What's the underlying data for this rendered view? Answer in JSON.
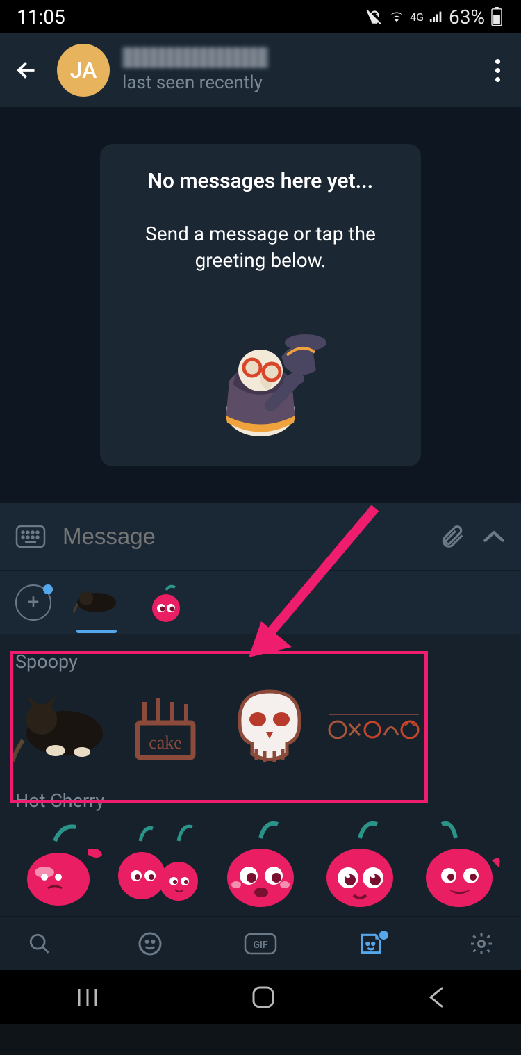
{
  "status": {
    "time": "11:05",
    "network": "4G",
    "battery": "63%"
  },
  "header": {
    "avatar_initials": "JA",
    "last_seen": "last seen recently"
  },
  "greeting": {
    "title": "No messages here yet...",
    "subtitle": "Send a message or tap the greeting below.",
    "sticker_name": "plague-doctor-greeting-sticker"
  },
  "input": {
    "placeholder": "Message"
  },
  "sticker_tabs": {
    "packs": [
      "spoopy-cat-thumb",
      "hot-cherry-thumb"
    ],
    "active_index": 0
  },
  "packs": [
    {
      "name": "Spoopy",
      "stickers": [
        "cat-sticker",
        "cake-sticker",
        "skull-sticker",
        "pumpkins-sticker"
      ]
    },
    {
      "name": "Hot Cherry",
      "stickers": [
        "cherry-1",
        "cherry-2",
        "cherry-3",
        "cherry-4",
        "cherry-5"
      ]
    }
  ],
  "bottom_toolbar": {
    "items": [
      "search",
      "emoji",
      "gif",
      "stickers",
      "settings"
    ],
    "active": "stickers"
  }
}
